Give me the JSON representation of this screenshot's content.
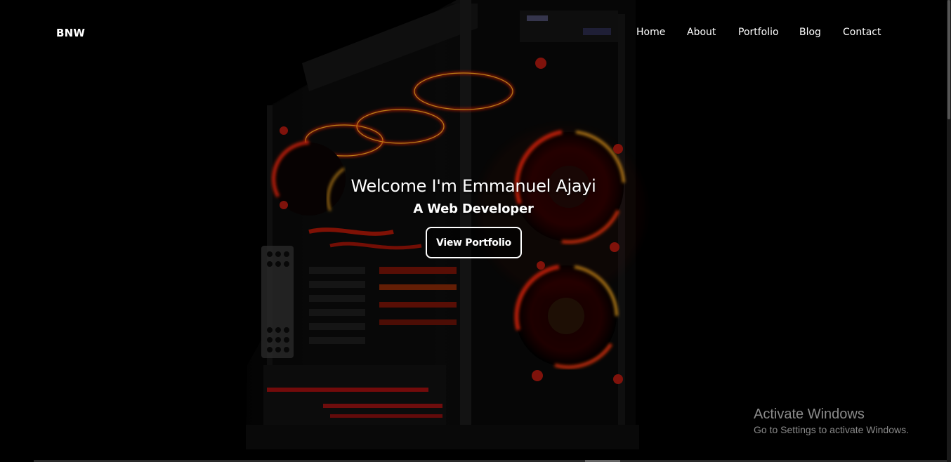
{
  "header": {
    "brand": "BNW",
    "nav": [
      {
        "label": "Home"
      },
      {
        "label": "About"
      },
      {
        "label": "Portfolio"
      },
      {
        "label": "Blog"
      },
      {
        "label": "Contact"
      }
    ]
  },
  "hero": {
    "title": "Welcome I'm Emmanuel Ajayi",
    "subtitle": "A Web Developer",
    "cta_label": "View Portfolio",
    "accent_color": "#e03010",
    "glow_color": "#ffb020"
  },
  "watermark": {
    "title": "Activate Windows",
    "subtitle": "Go to Settings to activate Windows."
  }
}
